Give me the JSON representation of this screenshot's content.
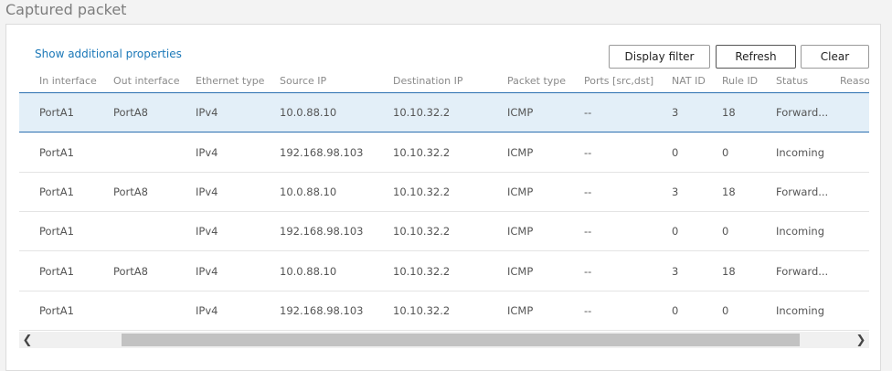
{
  "page": {
    "title": "Captured packet"
  },
  "toolbar": {
    "show_additional": "Show additional properties",
    "display_filter": "Display filter",
    "refresh": "Refresh",
    "clear": "Clear"
  },
  "table": {
    "headers": [
      "In interface",
      "Out interface",
      "Ethernet type",
      "Source IP",
      "Destination IP",
      "Packet type",
      "Ports [src,dst]",
      "NAT ID",
      "Rule ID",
      "Status",
      "Reason"
    ],
    "rows": [
      [
        "PortA1",
        "PortA8",
        "IPv4",
        "10.0.88.10",
        "10.10.32.2",
        "ICMP",
        "--",
        "3",
        "18",
        "Forward...",
        ""
      ],
      [
        "PortA1",
        "",
        "IPv4",
        "192.168.98.103",
        "10.10.32.2",
        "ICMP",
        "--",
        "0",
        "0",
        "Incoming",
        ""
      ],
      [
        "PortA1",
        "PortA8",
        "IPv4",
        "10.0.88.10",
        "10.10.32.2",
        "ICMP",
        "--",
        "3",
        "18",
        "Forward...",
        ""
      ],
      [
        "PortA1",
        "",
        "IPv4",
        "192.168.98.103",
        "10.10.32.2",
        "ICMP",
        "--",
        "0",
        "0",
        "Incoming",
        ""
      ],
      [
        "PortA1",
        "PortA8",
        "IPv4",
        "10.0.88.10",
        "10.10.32.2",
        "ICMP",
        "--",
        "3",
        "18",
        "Forward...",
        ""
      ],
      [
        "PortA1",
        "",
        "IPv4",
        "192.168.98.103",
        "10.10.32.2",
        "ICMP",
        "--",
        "0",
        "0",
        "Incoming",
        ""
      ]
    ],
    "selected_row": 0
  },
  "icons": {
    "scroll_left": "chevron-left-icon",
    "scroll_right": "chevron-right-icon"
  },
  "colors": {
    "accent": "#2a6fb0",
    "link": "#1b78b8",
    "selected_bg": "#e3eff8"
  }
}
